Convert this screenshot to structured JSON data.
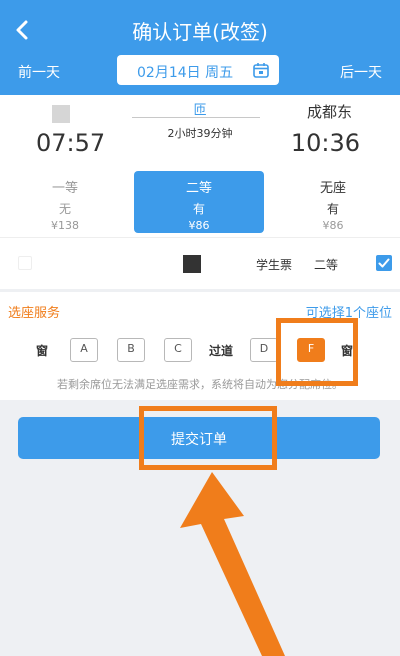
{
  "header": {
    "title": "确认订单(改签)",
    "prev_day": "前一天",
    "next_day": "后一天",
    "date": "02月14日 周五"
  },
  "trip": {
    "train_no": "匝",
    "duration": "2小时39分钟",
    "departure_time": "07:57",
    "arrival_station": "成都东",
    "arrival_time": "10:36"
  },
  "seats": [
    {
      "name": "一等",
      "availability": "无",
      "price": "¥138"
    },
    {
      "name": "二等",
      "availability": "有",
      "price": "¥86"
    },
    {
      "name": "无座",
      "availability": "有",
      "price": "¥86"
    }
  ],
  "passenger": {
    "ticket_type": "学生票",
    "seat_class": "二等"
  },
  "seat_service": {
    "title": "选座服务",
    "hint": "可选择1个座位",
    "window_label": "窗",
    "aisle_label": "过道",
    "seats_left": [
      "A",
      "B",
      "C"
    ],
    "seats_right": [
      "D",
      "F"
    ],
    "notice": "若剩余席位无法满足选座需求，系统将自动为您分配席位。"
  },
  "submit": {
    "label": "提交订单"
  },
  "colors": {
    "primary": "#3d9bea",
    "accent": "#f07d1b"
  }
}
